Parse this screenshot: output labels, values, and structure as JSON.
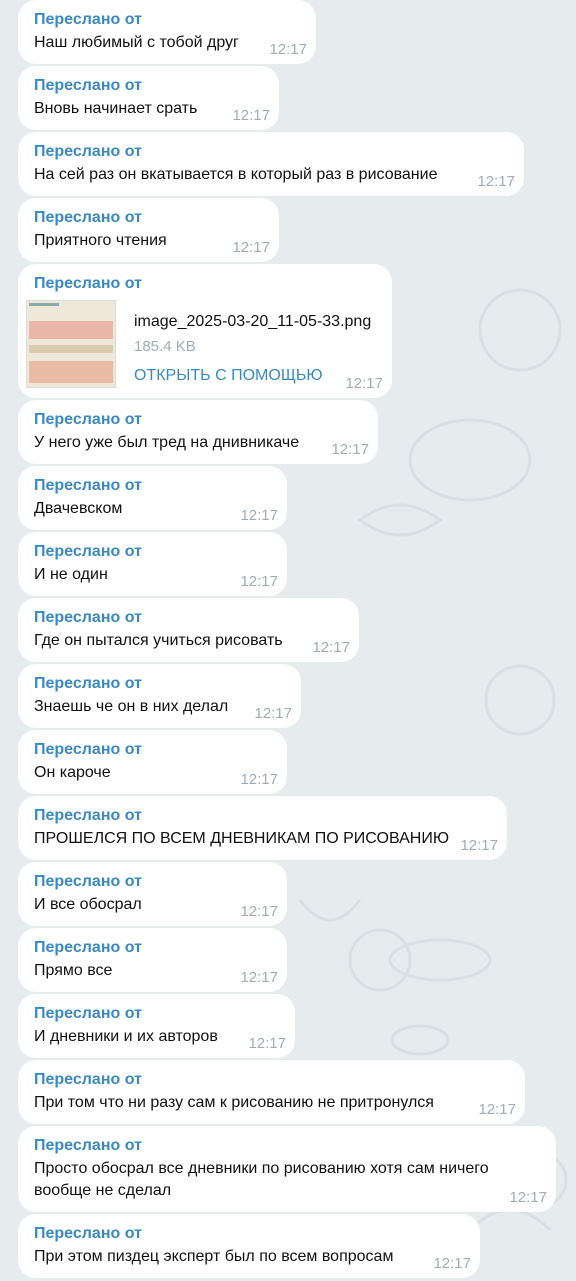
{
  "messages": [
    {
      "forward_label": "Переслано от",
      "text": "Наш любимый с тобой друг",
      "time": "12:17"
    },
    {
      "forward_label": "Переслано от",
      "text": "Вновь начинает срать",
      "time": "12:17"
    },
    {
      "forward_label": "Переслано от",
      "text": "На сей раз он вкатывается в который раз в рисование",
      "time": "12:17"
    },
    {
      "forward_label": "Переслано от",
      "text": "Приятного чтения",
      "time": "12:17"
    },
    {
      "forward_label": "Переслано от",
      "file_name": "image_2025-03-20_11-05-33.png",
      "file_size": "185.4 KB",
      "open_label": "ОТКРЫТЬ С ПОМОЩЬЮ",
      "time": "12:17"
    },
    {
      "forward_label": "Переслано от",
      "text": "У него уже был тред на днивникаче",
      "time": "12:17"
    },
    {
      "forward_label": "Переслано от",
      "text": "Двачевском",
      "time": "12:17"
    },
    {
      "forward_label": "Переслано от",
      "text": "И не один",
      "time": "12:17"
    },
    {
      "forward_label": "Переслано от",
      "text": "Где он пытался учиться рисовать",
      "time": "12:17"
    },
    {
      "forward_label": "Переслано от",
      "text": "Знаешь че он в них делал",
      "time": "12:17"
    },
    {
      "forward_label": "Переслано от",
      "text": "Он кароче",
      "time": "12:17"
    },
    {
      "forward_label": "Переслано от",
      "text": "ПРОШЕЛСЯ ПО ВСЕМ ДНЕВНИКАМ ПО РИСОВАНИЮ",
      "time": "12:17"
    },
    {
      "forward_label": "Переслано от",
      "text": "И все обосрал",
      "time": "12:17"
    },
    {
      "forward_label": "Переслано от",
      "text": "Прямо все",
      "time": "12:17"
    },
    {
      "forward_label": "Переслано от",
      "text": "И дневники и их авторов",
      "time": "12:17"
    },
    {
      "forward_label": "Переслано от",
      "text": "При том что ни разу сам к рисованию не притронулся",
      "time": "12:17"
    },
    {
      "forward_label": "Переслано от",
      "text": "Просто обосрал все дневники по рисованию хотя сам ничего вообще не сделал",
      "time": "12:17"
    },
    {
      "forward_label": "Переслано от",
      "text": "При этом пиздец эксперт был по всем вопросам",
      "time": "12:17"
    }
  ],
  "colors": {
    "background": "#e6ebee",
    "bubble": "#ffffff",
    "accent": "#3a8ac2",
    "time": "#a0acb6"
  }
}
